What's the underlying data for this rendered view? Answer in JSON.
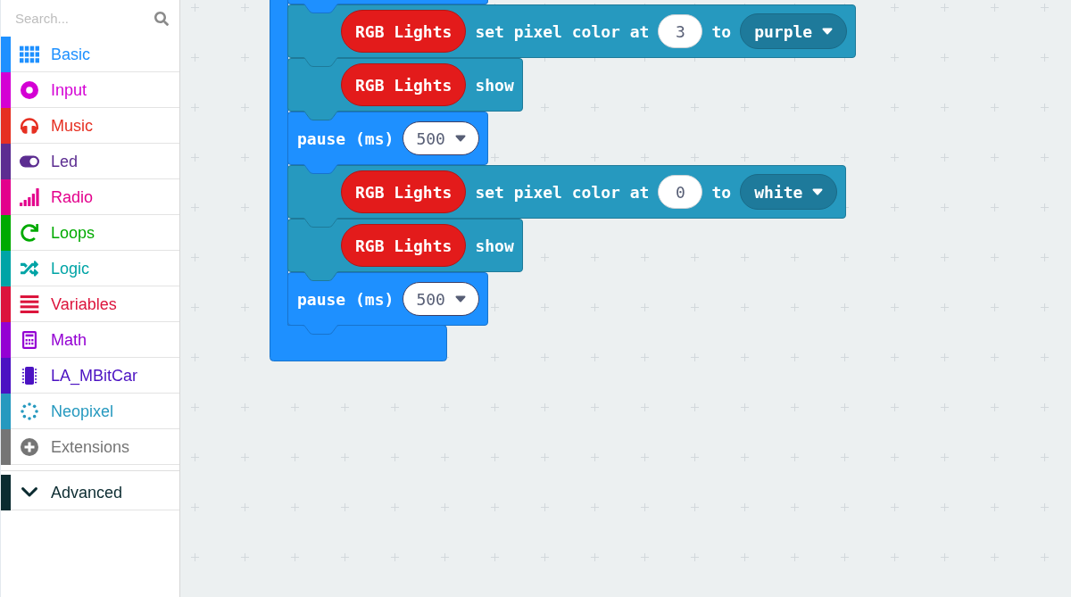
{
  "sidebar": {
    "search": {
      "placeholder": "Search..."
    },
    "categories": [
      {
        "label": "Basic",
        "color": "#1e90ff"
      },
      {
        "label": "Input",
        "color": "#d400d4"
      },
      {
        "label": "Music",
        "color": "#e63022"
      },
      {
        "label": "Led",
        "color": "#5c2d91"
      },
      {
        "label": "Radio",
        "color": "#e3008c"
      },
      {
        "label": "Loops",
        "color": "#00aa00"
      },
      {
        "label": "Logic",
        "color": "#00a4a6"
      },
      {
        "label": "Variables",
        "color": "#dc143c"
      },
      {
        "label": "Math",
        "color": "#9400d3"
      },
      {
        "label": "LA_MBitCar",
        "color": "#4b12c2"
      },
      {
        "label": "Neopixel",
        "color": "#2699bf"
      },
      {
        "label": "Extensions",
        "color": "#757575"
      }
    ],
    "advanced": {
      "label": "Advanced",
      "color": "#0b2b30",
      "expanded": false
    }
  },
  "workspace": {
    "loop_block": {
      "statements": [
        {
          "kind": "set_pixel_color",
          "variable": "RGB Lights",
          "label": "set pixel color at",
          "index": "3",
          "label_2": "to",
          "value": "purple"
        },
        {
          "kind": "show",
          "variable": "RGB Lights",
          "label": "show"
        },
        {
          "kind": "pause",
          "label": "pause (ms)",
          "value": "500"
        },
        {
          "kind": "set_pixel_color",
          "variable": "RGB Lights",
          "label": "set pixel color at",
          "index": "0",
          "label_2": "to",
          "value": "white"
        },
        {
          "kind": "show",
          "variable": "RGB Lights",
          "label": "show"
        },
        {
          "kind": "pause",
          "label": "pause (ms)",
          "value": "500"
        }
      ]
    }
  }
}
